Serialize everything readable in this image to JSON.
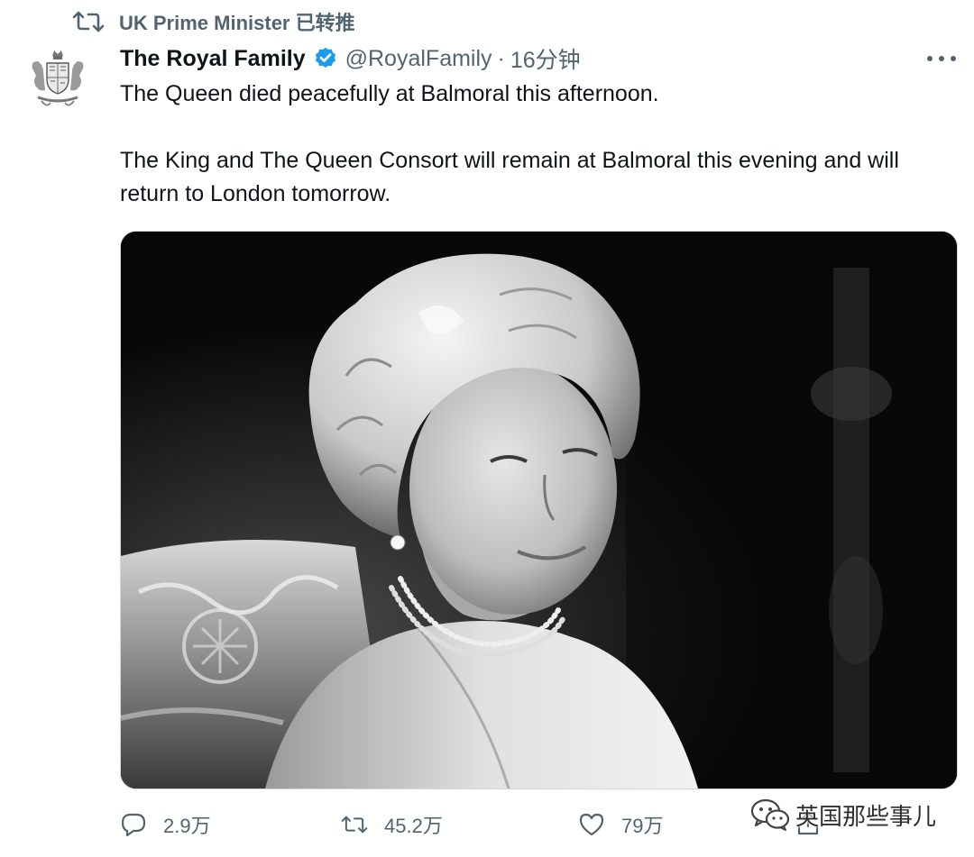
{
  "retweet_context": {
    "text": "UK Prime Minister 已转推",
    "icon": "retweet-icon"
  },
  "author": {
    "name": "The Royal Family",
    "handle": "@RoyalFamily",
    "separator": "·",
    "time": "16分钟",
    "verified": true,
    "verified_color": "#1d9bf0",
    "avatar_icon": "royal-coat-of-arms"
  },
  "tweet": {
    "paragraphs": [
      "The Queen died peacefully at Balmoral this afternoon.",
      "The King and The Queen Consort will remain at Balmoral this evening and will return to London tomorrow."
    ]
  },
  "media": {
    "type": "photo",
    "style": "black-and-white portrait"
  },
  "actions": {
    "reply": {
      "icon": "reply-icon",
      "count": "2.9万"
    },
    "retweet": {
      "icon": "retweet-icon",
      "count": "45.2万"
    },
    "like": {
      "icon": "heart-icon",
      "count": "79万"
    },
    "share": {
      "icon": "share-icon"
    }
  },
  "watermark": {
    "text": "英国那些事儿",
    "icon": "wechat-icon"
  },
  "colors": {
    "text_primary": "#0f1419",
    "text_secondary": "#536471",
    "border": "#cfd9de"
  }
}
